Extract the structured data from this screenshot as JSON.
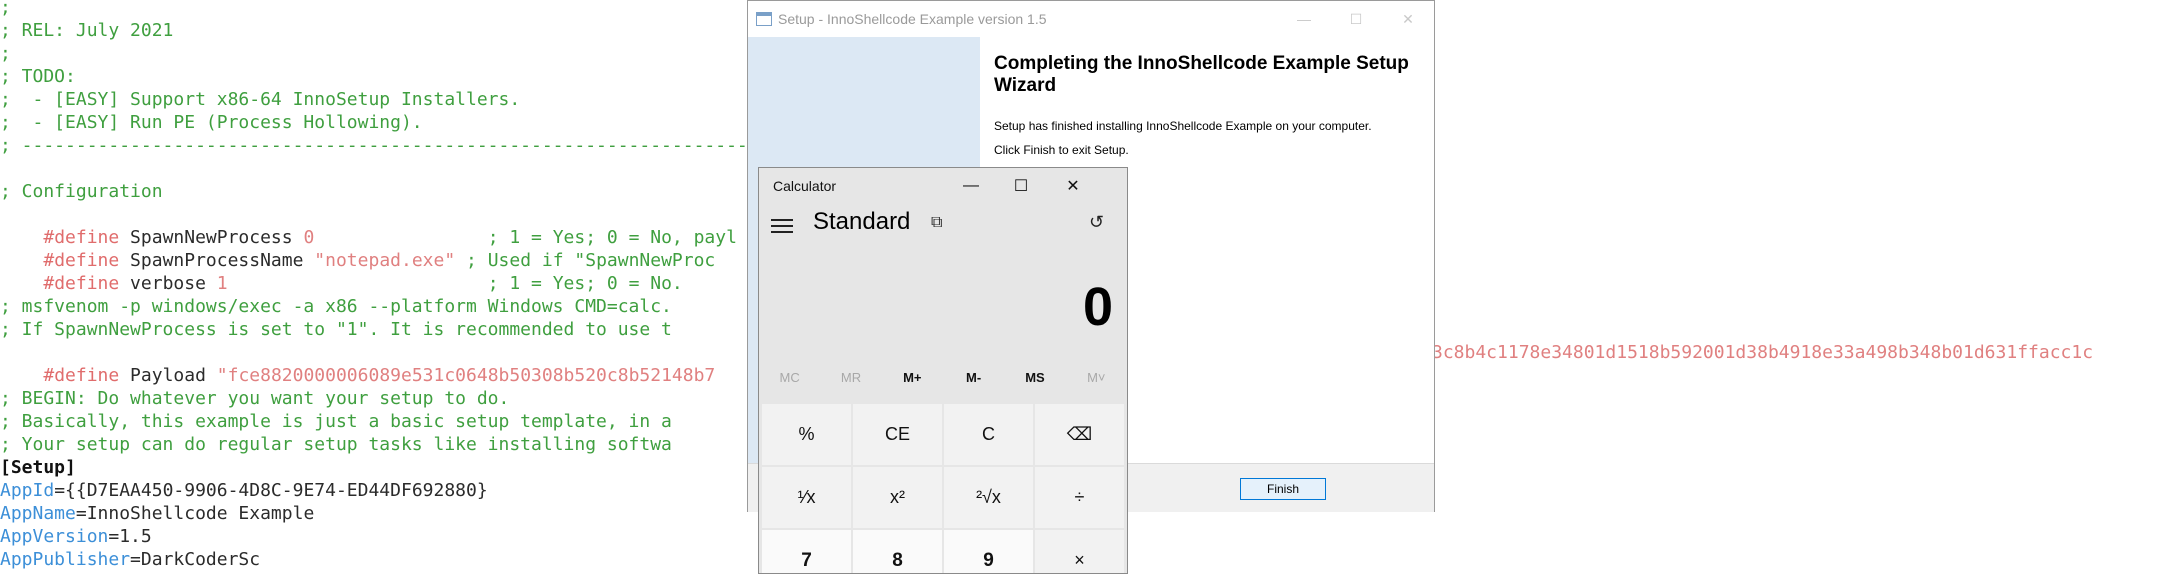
{
  "editor": {
    "lines": [
      ";",
      "; REL: July 2021",
      ";",
      "; TODO:",
      ";  - [EASY] Support x86-64 InnoSetup Installers.",
      ";  - [EASY] Run PE (Process Hollowing).",
      "; ------------------------------------------------------------------------",
      "",
      "; Configuration",
      "",
      "",
      "",
      "",
      "; msfvenom -p windows/exec -a x86 --platform Windows CMD=calc.",
      "; If SpawnNewProcess is set to \"1\". It is recommended to use t",
      "",
      "",
      "; BEGIN: Do whatever you want your setup to do.",
      "; Basically, this example is just a basic setup template, in a",
      "; Your setup can do regular setup tasks like installing softwa",
      "",
      "",
      "",
      "",
      ""
    ],
    "define_kw": "#define",
    "defines": [
      {
        "name": " SpawnNewProcess ",
        "value": "0",
        "comment": "                ; 1 = Yes; 0 = No, payl"
      },
      {
        "name": " SpawnProcessName ",
        "value": "\"notepad.exe\"",
        "comment": " ; Used if \"SpawnNewProc"
      },
      {
        "name": " verbose ",
        "value": "1",
        "comment": "                        ; 1 = Yes; 0 = No."
      },
      {
        "name": " Payload ",
        "value": "\"fce8820000006089e531c0648b50308b520c8b52148b7",
        "comment": ""
      }
    ],
    "payload_tail": "3c8b4c1178e34801d1518b592001d38b4918e33a498b348b01d631ffacc1c",
    "setup_section": "[Setup]",
    "setup_keys": [
      {
        "key": "AppId",
        "value": "{{D7EAA450-9906-4D8C-9E74-ED44DF692880}"
      },
      {
        "key": "AppName",
        "value": "InnoShellcode Example"
      },
      {
        "key": "AppVersion",
        "value": "1.5"
      },
      {
        "key": "AppPublisher",
        "value": "DarkCoderSc"
      }
    ]
  },
  "setup_window": {
    "title": "Setup - InnoShellcode Example version 1.5",
    "heading": "Completing the InnoShellcode Example Setup Wizard",
    "line1": "Setup has finished installing InnoShellcode Example on your computer.",
    "line2": "Click Finish to exit Setup.",
    "finish_label": "Finish",
    "controls": {
      "min": "—",
      "max": "☐",
      "close": "✕"
    }
  },
  "calculator": {
    "title": "Calculator",
    "mode": "Standard",
    "display": "0",
    "controls": {
      "min": "—",
      "max": "☐",
      "close": "✕"
    },
    "memory": [
      "MC",
      "MR",
      "M+",
      "M-",
      "MS",
      "M˅"
    ],
    "keys": [
      "%",
      "CE",
      "C",
      "⌫",
      "¹⁄x",
      "x²",
      "²√x",
      "÷",
      "7",
      "8",
      "9",
      "×"
    ]
  }
}
